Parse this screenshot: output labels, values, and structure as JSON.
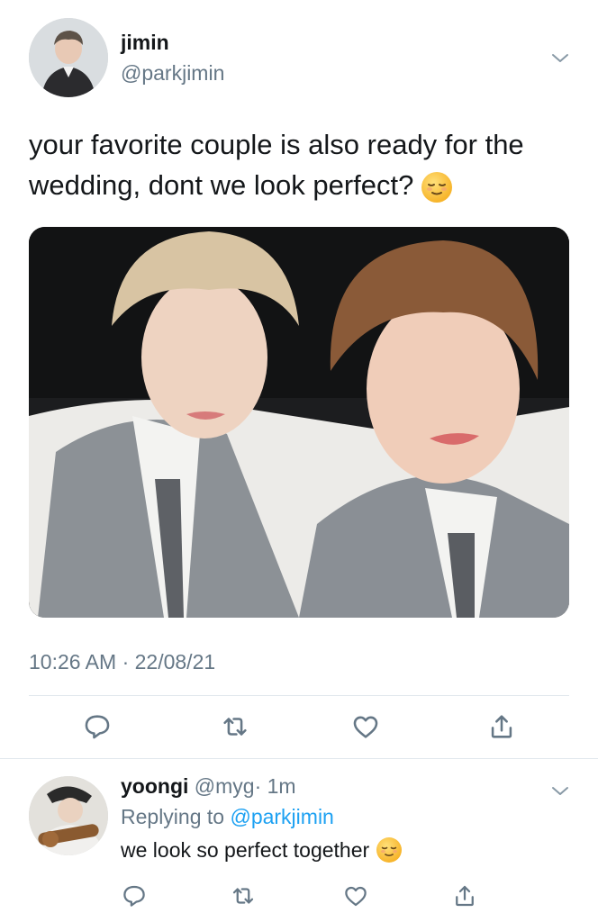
{
  "tweet": {
    "display_name": "jimin",
    "handle": "@parkjimin",
    "text": "your favorite couple is also ready for the wedding, dont we look perfect?",
    "emoji": "relieved-face",
    "timestamp": "10:26 AM · 22/08/21",
    "actions": [
      "reply-icon",
      "retweet-icon",
      "like-icon",
      "share-icon"
    ]
  },
  "reply": {
    "display_name": "yoongi",
    "handle": "@myg",
    "time": "· 1m",
    "replying_prefix": "Replying to",
    "replying_to": "@parkjimin",
    "text": "we look so perfect together",
    "emoji": "relieved-face",
    "actions": [
      "reply-icon",
      "retweet-icon",
      "like-icon",
      "share-icon"
    ]
  },
  "colors": {
    "text": "#14171a",
    "secondary": "#657786",
    "link": "#1da1f2",
    "divider": "#e1e8ed"
  }
}
